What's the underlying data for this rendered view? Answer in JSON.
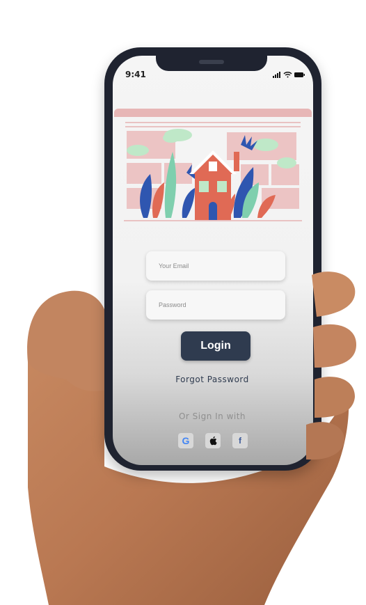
{
  "status_bar": {
    "time": "9:41"
  },
  "login_form": {
    "email_placeholder": "Your Email",
    "password_placeholder": "Password",
    "login_label": "Login",
    "forgot_password": "Forgot Password",
    "or_sign_in": "Or Sign In with"
  },
  "social": [
    {
      "name": "google",
      "icon": "google-icon"
    },
    {
      "name": "apple",
      "icon": "apple-icon"
    },
    {
      "name": "facebook",
      "icon": "facebook-icon"
    }
  ],
  "colors": {
    "primary_button": "#2f3b4f",
    "house": "#e06a55",
    "accent_pink": "#e7b6b6",
    "leaf_blue": "#2f56b0",
    "leaf_green": "#7fcfae",
    "cloud": "#bfe8c8"
  }
}
